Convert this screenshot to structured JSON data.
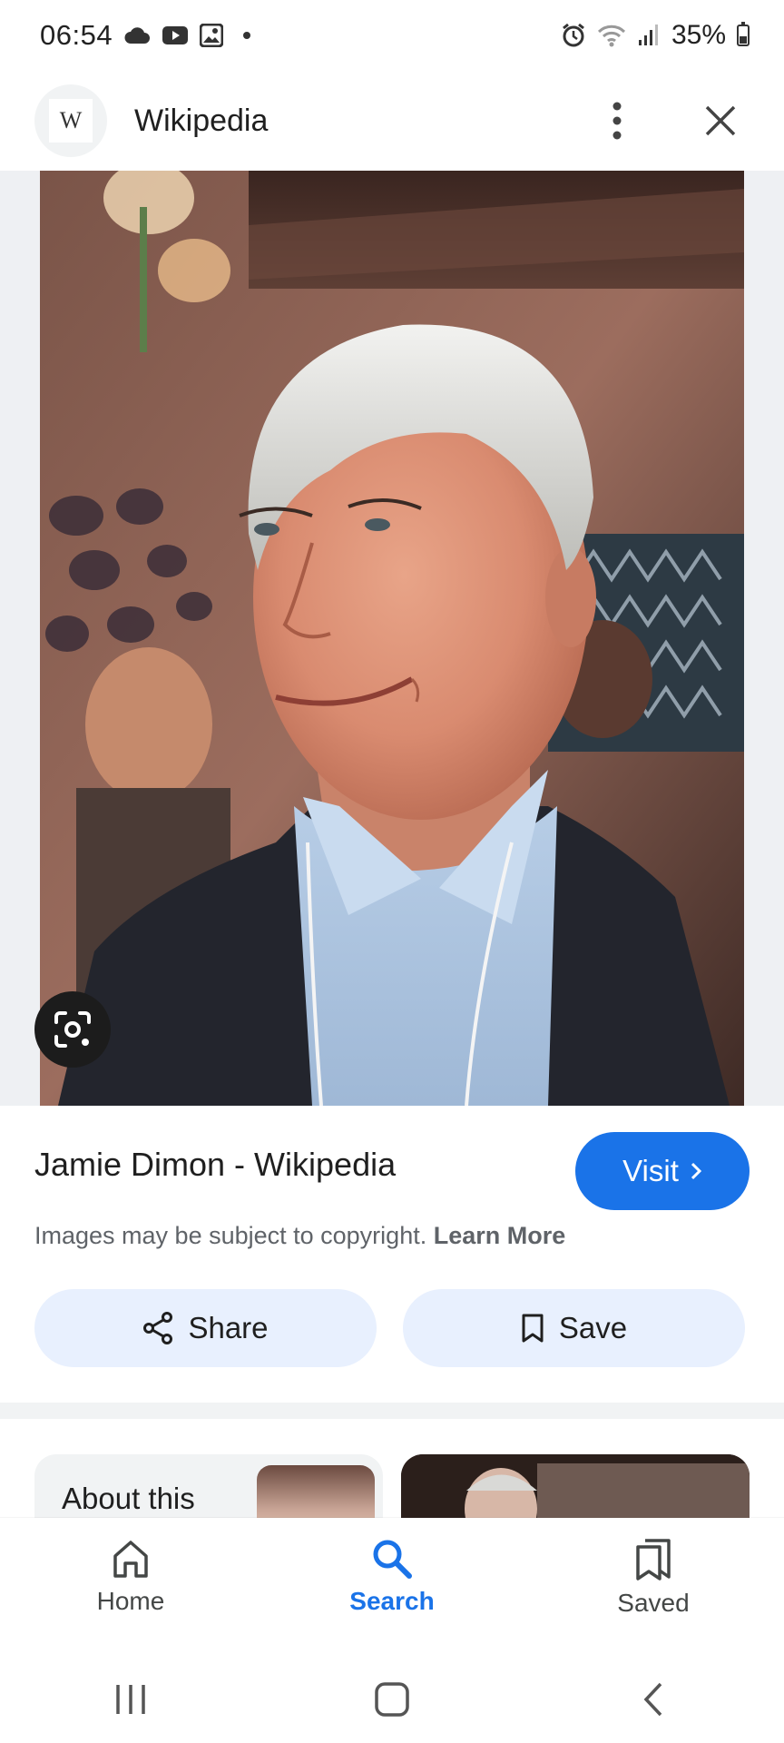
{
  "status_bar": {
    "time": "06:54",
    "left_icons": [
      "cloud-icon",
      "youtube-icon",
      "gallery-icon",
      "notification-dot"
    ],
    "right_icons": [
      "alarm-icon",
      "wifi-icon",
      "signal-icon",
      "battery-icon"
    ],
    "battery": "35%"
  },
  "header": {
    "site_logo": "W",
    "site_name": "Wikipedia",
    "menu_icon": "more-vert-icon",
    "close_icon": "close-icon"
  },
  "image": {
    "description_icon": "lens-icon"
  },
  "result": {
    "title": "Jamie Dimon - Wikipedia",
    "visit_label": "Visit",
    "copyright_text": "Images may be subject to copyright.",
    "learn_more": "Learn More"
  },
  "actions": {
    "share_label": "Share",
    "save_label": "Save"
  },
  "cards": {
    "about_title": "About this"
  },
  "bottom_nav": {
    "items": [
      {
        "label": "Home",
        "icon": "home-icon"
      },
      {
        "label": "Search",
        "icon": "search-icon"
      },
      {
        "label": "Saved",
        "icon": "saved-icon"
      }
    ],
    "active": "Search"
  },
  "colors": {
    "accent": "#1a73e8",
    "pill_bg": "#e8f0fe"
  }
}
